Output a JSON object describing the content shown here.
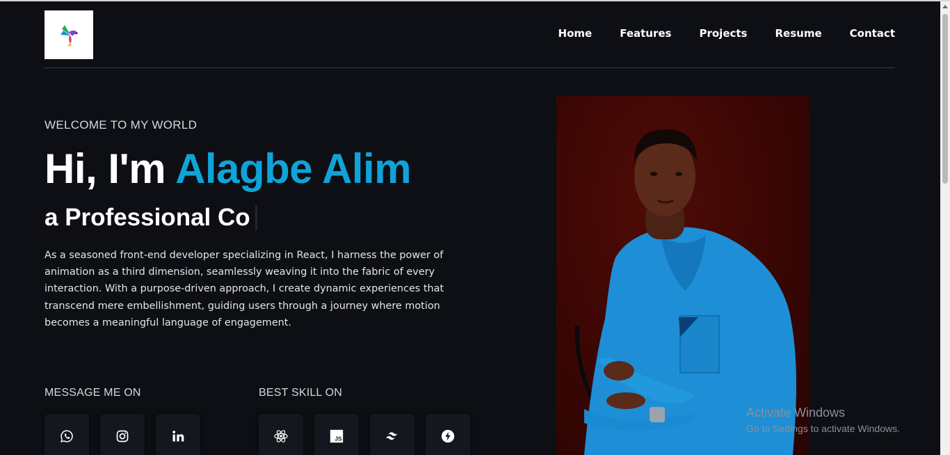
{
  "nav": {
    "items": [
      "Home",
      "Features",
      "Projects",
      "Resume",
      "Contact"
    ]
  },
  "hero": {
    "welcome": "WELCOME TO MY WORLD",
    "greeting": "Hi, I'm ",
    "name": "Alagbe Alim",
    "typed_text": "a Professional Co",
    "bio": "As a seasoned front-end developer specializing in React, I harness the power of animation as a third dimension, seamlessly weaving it into the fabric of every interaction. With a purpose-driven approach, I create dynamic experiences that transcend mere embellishment, guiding users through a journey where motion becomes a meaningful language of engagement.",
    "accent_color": "#10a3d8"
  },
  "social": {
    "label": "MESSAGE ME ON",
    "icons": [
      "whatsapp-icon",
      "instagram-icon",
      "linkedin-icon"
    ]
  },
  "skills": {
    "label": "BEST SKILL ON",
    "icons": [
      "react-icon",
      "javascript-icon",
      "tailwind-icon",
      "bolt-icon"
    ],
    "js_badge": "JS"
  },
  "watermark": {
    "title": "Activate Windows",
    "subtitle": "Go to Settings to activate Windows."
  }
}
